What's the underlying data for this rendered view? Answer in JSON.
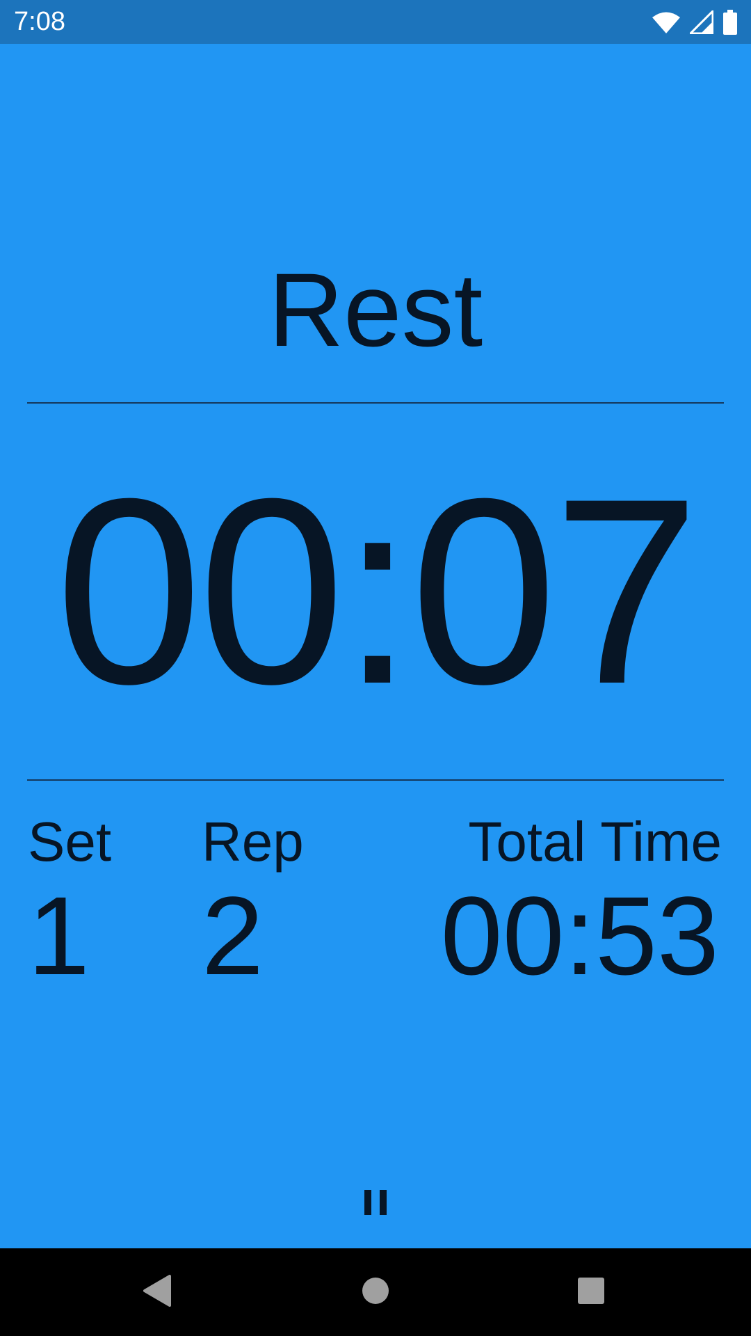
{
  "status_bar": {
    "time": "7:08",
    "icons": [
      "wifi-icon",
      "cell-signal-icon",
      "battery-icon"
    ]
  },
  "workout": {
    "mode": "Rest",
    "countdown": "00:07",
    "set_label": "Set",
    "set_value": "1",
    "rep_label": "Rep",
    "rep_value": "2",
    "total_time_label": "Total Time",
    "total_time_value": "00:53"
  },
  "controls": {
    "pause_icon": "pause-icon"
  },
  "nav_bar": {
    "buttons": [
      "back-icon",
      "home-icon",
      "recents-icon"
    ]
  },
  "colors": {
    "background": "#2196F3",
    "status_bar": "#1C74BC",
    "text": "#071525",
    "nav_bar": "#000000"
  }
}
